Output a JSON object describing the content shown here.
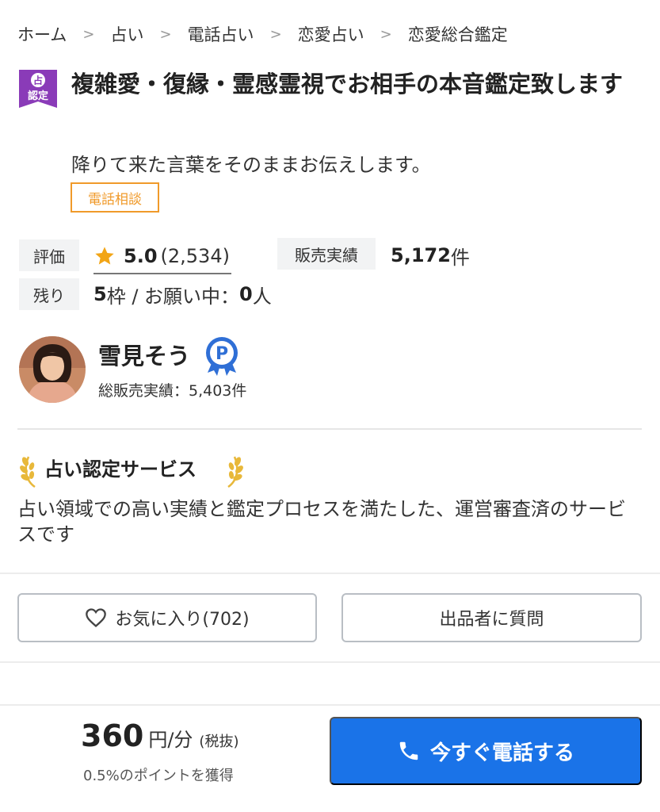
{
  "breadcrumb": {
    "items": [
      "ホーム",
      "占い",
      "電話占い",
      "恋愛占い",
      "恋愛総合鑑定"
    ],
    "separator": ">"
  },
  "badge": {
    "top": "占",
    "bottom": "認定",
    "color": "#8a3bb8"
  },
  "service": {
    "title": "複雑愛・復縁・霊感霊視でお相手の本音鑑定致します",
    "subtitle": "降りて来た言葉をそのままお伝えします。",
    "tag": "電話相談"
  },
  "stats": {
    "rating_label": "評価",
    "rating_score": "5.0",
    "rating_count": "(2,534)",
    "sales_label": "販売実績",
    "sales_value": "5,172",
    "sales_unit": "件",
    "remain_label": "残り",
    "remain_slots": "5",
    "remain_slots_unit": "枠",
    "remain_sep": " / お願い中：",
    "remain_requests": "0",
    "remain_requests_unit": "人"
  },
  "seller": {
    "name": "雪見そう",
    "total_sales": "総販売実績：5,403件",
    "pro_badge": "P"
  },
  "certification": {
    "title": "占い認定サービス",
    "description": "占い領域での高い実績と鑑定プロセスを満たした、運営審査済のサービスです"
  },
  "actions": {
    "favorite_label": "お気に入り(702)",
    "ask_label": "出品者に質問"
  },
  "purchase": {
    "price": "360",
    "unit": "円/分",
    "tax": "(税抜)",
    "points": "0.5%のポイントを獲得",
    "call_label": "今すぐ電話する"
  },
  "colors": {
    "accent_blue": "#1a73e8",
    "tag_orange": "#f09a2a",
    "star": "#f2a516",
    "laurel": "#e8b83a"
  }
}
